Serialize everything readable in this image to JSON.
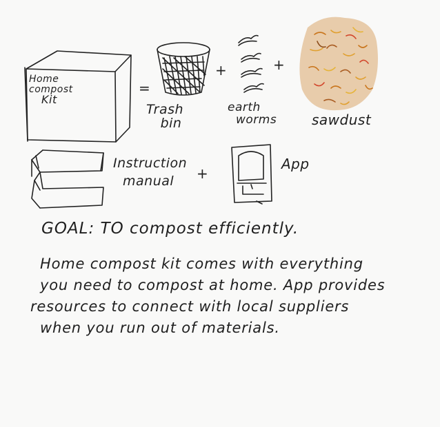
{
  "kit_label": [
    "Home",
    "compost",
    "Kit"
  ],
  "trash_label": [
    "Trash",
    "bin"
  ],
  "worms_label": [
    "earth",
    "worms"
  ],
  "sawdust_label": "sawdust",
  "manual_label": [
    "Instruction",
    "manual"
  ],
  "app_label": "App",
  "goal": "GOAL: TO compost efficiently.",
  "description": [
    "Home compost kit comes with everything",
    "you need to compost at home. App provides",
    "resources to connect with local suppliers",
    "when you run out of materials."
  ],
  "symbols": {
    "equals": "=",
    "plus": "+"
  },
  "colors": {
    "sawdust_bg": "#e8ccab",
    "ink": "#222222"
  }
}
